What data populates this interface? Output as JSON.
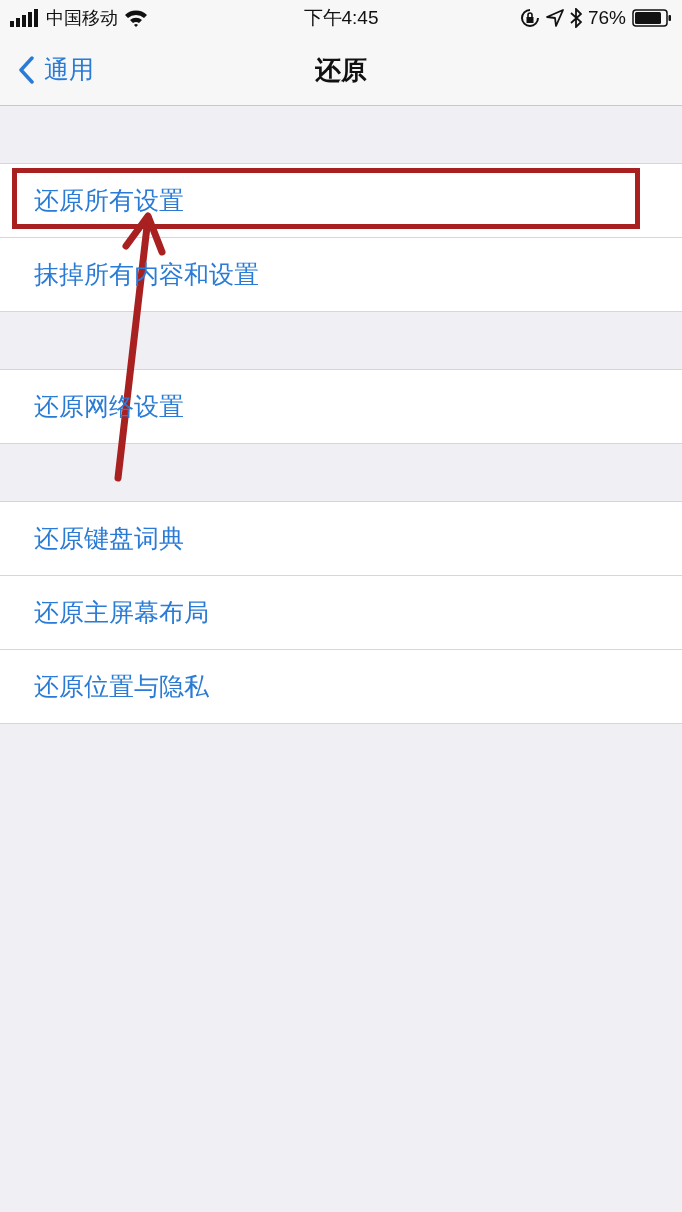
{
  "status_bar": {
    "carrier": "中国移动",
    "time": "下午4:45",
    "battery": "76%"
  },
  "nav": {
    "back": "通用",
    "title": "还原"
  },
  "groups": [
    {
      "items": [
        {
          "label": "还原所有设置",
          "highlighted": true
        },
        {
          "label": "抹掉所有内容和设置",
          "highlighted": false
        }
      ]
    },
    {
      "items": [
        {
          "label": "还原网络设置",
          "highlighted": false
        }
      ]
    },
    {
      "items": [
        {
          "label": "还原键盘词典",
          "highlighted": false
        },
        {
          "label": "还原主屏幕布局",
          "highlighted": false
        },
        {
          "label": "还原位置与隐私",
          "highlighted": false
        }
      ]
    }
  ],
  "annotation_arrow": true
}
